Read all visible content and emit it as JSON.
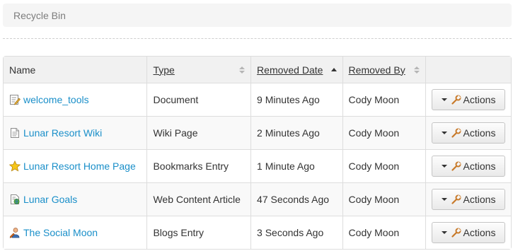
{
  "breadcrumb": {
    "label": "Recycle Bin"
  },
  "table": {
    "columns": {
      "name": "Name",
      "type": "Type",
      "removed_date": "Removed Date",
      "removed_by": "Removed By"
    },
    "sort": {
      "column": "removed_date",
      "direction": "ascending"
    },
    "rows": [
      {
        "name": "welcome_tools",
        "icon": "document-edit-icon",
        "type": "Document",
        "removed_date": "9 Minutes Ago",
        "removed_by": "Cody Moon",
        "actions_label": "Actions"
      },
      {
        "name": "Lunar Resort Wiki",
        "icon": "wiki-page-icon",
        "type": "Wiki Page",
        "removed_date": "2 Minutes Ago",
        "removed_by": "Cody Moon",
        "actions_label": "Actions"
      },
      {
        "name": "Lunar Resort Home Page",
        "icon": "star-icon",
        "type": "Bookmarks Entry",
        "removed_date": "1 Minute Ago",
        "removed_by": "Cody Moon",
        "actions_label": "Actions"
      },
      {
        "name": "Lunar Goals",
        "icon": "web-content-icon",
        "type": "Web Content Article",
        "removed_date": "47 Seconds Ago",
        "removed_by": "Cody Moon",
        "actions_label": "Actions"
      },
      {
        "name": "The Social Moon",
        "icon": "blog-entry-icon",
        "type": "Blogs Entry",
        "removed_date": "3 Seconds Ago",
        "removed_by": "Cody Moon",
        "actions_label": "Actions"
      }
    ]
  },
  "colors": {
    "link": "#1a8fc9",
    "header_bg": "#f1f1f1",
    "breadcrumb_bg": "#f5f5f5"
  }
}
